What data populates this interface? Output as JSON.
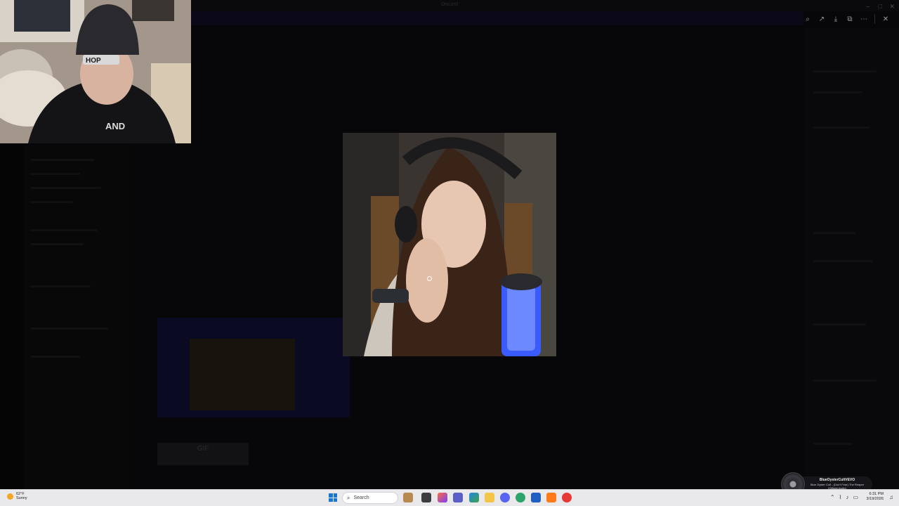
{
  "background_app": {
    "title": "Discord",
    "attachment_label": "GIF"
  },
  "viewer": {
    "toolbar": [
      {
        "icon": "zoom-icon",
        "glyph": "⌕"
      },
      {
        "icon": "share-icon",
        "glyph": "↗"
      },
      {
        "icon": "download-icon",
        "glyph": "⤓"
      },
      {
        "icon": "open-external-icon",
        "glyph": "⧉"
      },
      {
        "icon": "more-icon",
        "glyph": "⋯"
      },
      {
        "icon": "close-icon",
        "glyph": "✕"
      }
    ],
    "image_caption": "a camera selfie of a woman with long brown hair, headphones and a glowing blue microphone"
  },
  "webcam": {
    "hat_text": "HOP",
    "shirt_text": "AND"
  },
  "taskbar": {
    "weather": {
      "temp": "62°F",
      "condition": "Sunny"
    },
    "search_placeholder": "Search",
    "clock": {
      "time": "6:31 PM",
      "date": "3/19/2026"
    }
  },
  "now_playing": {
    "artist": "BlueOysterCultVEVO",
    "title": "Blue Oyster Cult - (Don't Fear) The Reaper (Official Audio)"
  },
  "colors": {
    "accent": "#1976d2",
    "banner": "#0b0818",
    "mic_glow": "#3a5cff"
  }
}
